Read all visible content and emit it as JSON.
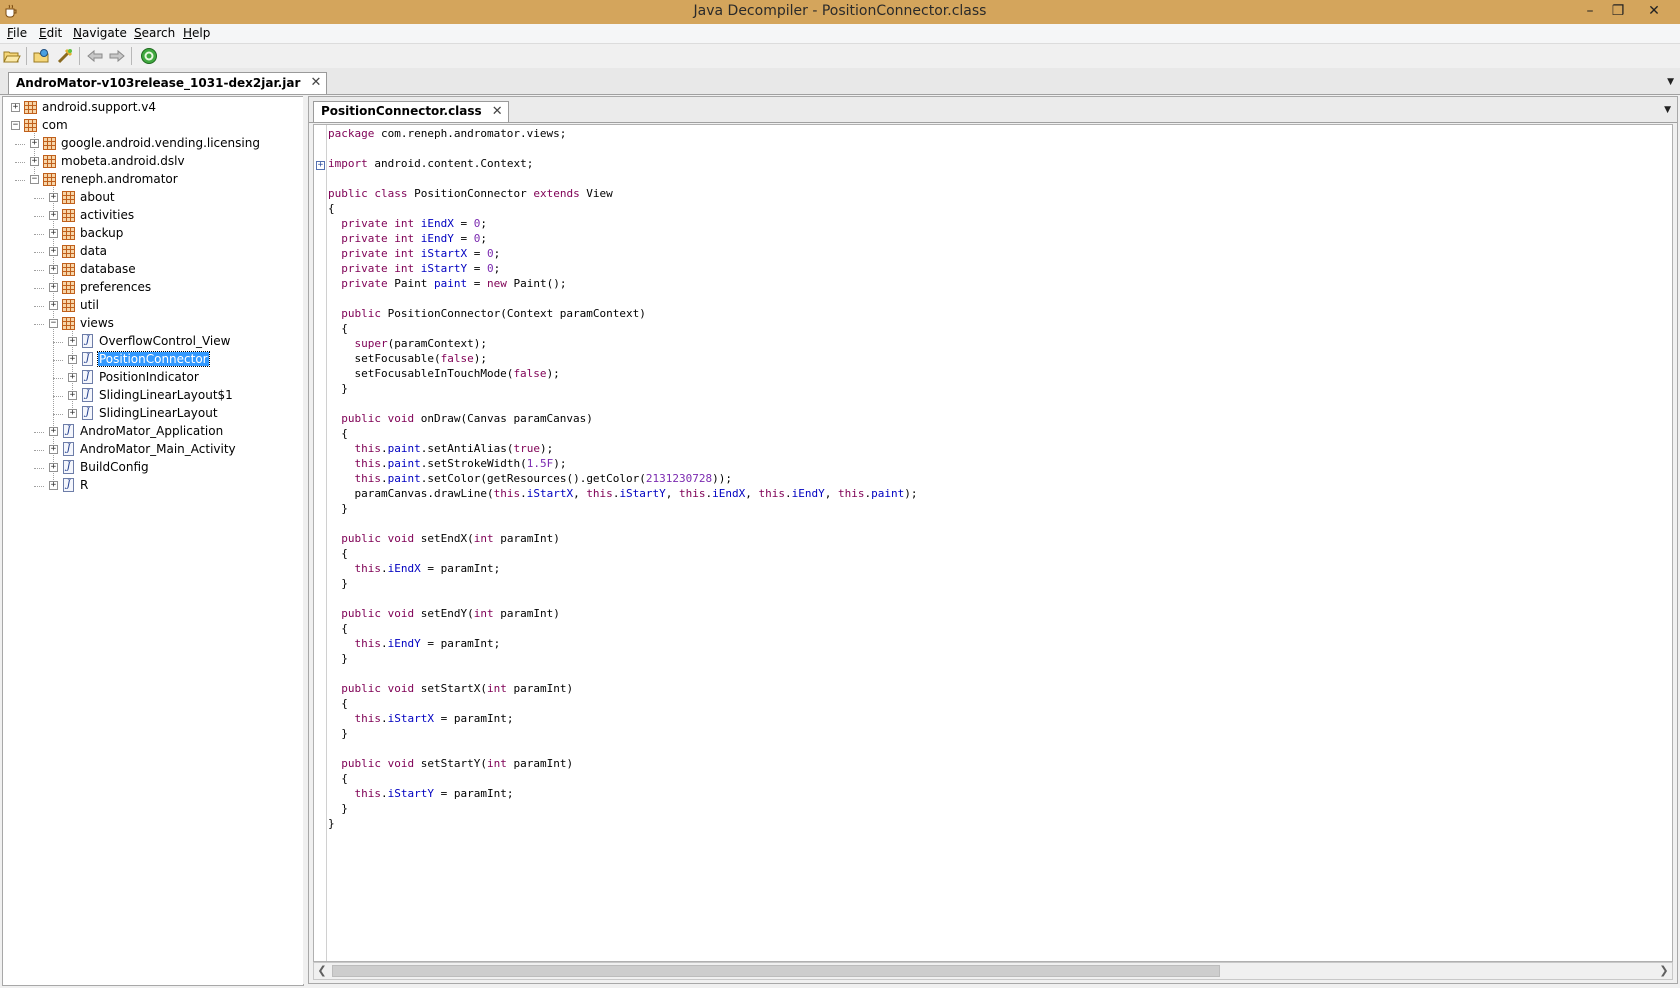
{
  "window": {
    "title": "Java Decompiler - PositionConnector.class",
    "minimize": "–",
    "restore": "❐",
    "close": "✕"
  },
  "menu": [
    {
      "label": "File",
      "mnemonic": "F",
      "rest": "ile"
    },
    {
      "label": "Edit",
      "mnemonic": "E",
      "rest": "dit"
    },
    {
      "label": "Navigate",
      "mnemonic": "N",
      "rest": "avigate"
    },
    {
      "label": "Search",
      "mnemonic": "S",
      "rest": "earch"
    },
    {
      "label": "Help",
      "mnemonic": "H",
      "rest": "elp"
    }
  ],
  "toolbar": {
    "icons": [
      "open-file-icon",
      "open-type-icon",
      "open-type-hierarchy-icon",
      "back-icon",
      "forward-icon",
      "about-icon"
    ]
  },
  "outer_tab": {
    "label": "AndroMator-v103release_1031-dex2jar.jar",
    "close": "✕"
  },
  "editor_tab": {
    "label": "PositionConnector.class",
    "close": "✕"
  },
  "tree": [
    {
      "label": "android.support.v4",
      "type": "package",
      "depth": 0,
      "expanded": false
    },
    {
      "label": "com",
      "type": "package",
      "depth": 0,
      "expanded": true
    },
    {
      "label": "google.android.vending.licensing",
      "type": "package",
      "depth": 1,
      "expanded": false
    },
    {
      "label": "mobeta.android.dslv",
      "type": "package",
      "depth": 1,
      "expanded": false
    },
    {
      "label": "reneph.andromator",
      "type": "package",
      "depth": 1,
      "expanded": true
    },
    {
      "label": "about",
      "type": "package",
      "depth": 2,
      "expanded": false
    },
    {
      "label": "activities",
      "type": "package",
      "depth": 2,
      "expanded": false
    },
    {
      "label": "backup",
      "type": "package",
      "depth": 2,
      "expanded": false
    },
    {
      "label": "data",
      "type": "package",
      "depth": 2,
      "expanded": false
    },
    {
      "label": "database",
      "type": "package",
      "depth": 2,
      "expanded": false
    },
    {
      "label": "preferences",
      "type": "package",
      "depth": 2,
      "expanded": false
    },
    {
      "label": "util",
      "type": "package",
      "depth": 2,
      "expanded": false
    },
    {
      "label": "views",
      "type": "package",
      "depth": 2,
      "expanded": true
    },
    {
      "label": "OverflowControl_View",
      "type": "class",
      "depth": 3,
      "expanded": false
    },
    {
      "label": "PositionConnector",
      "type": "class",
      "depth": 3,
      "expanded": false,
      "selected": true
    },
    {
      "label": "PositionIndicator",
      "type": "class",
      "depth": 3,
      "expanded": false
    },
    {
      "label": "SlidingLinearLayout$1",
      "type": "class",
      "depth": 3,
      "expanded": false
    },
    {
      "label": "SlidingLinearLayout",
      "type": "class",
      "depth": 3,
      "expanded": false
    },
    {
      "label": "AndroMator_Application",
      "type": "class",
      "depth": 2,
      "expanded": false
    },
    {
      "label": "AndroMator_Main_Activity",
      "type": "class",
      "depth": 2,
      "expanded": false
    },
    {
      "label": "BuildConfig",
      "type": "class",
      "depth": 2,
      "expanded": false
    },
    {
      "label": "R",
      "type": "class",
      "depth": 2,
      "expanded": false
    }
  ],
  "code": [
    [
      [
        "k",
        "package"
      ],
      [
        "t",
        " com.reneph.andromator.views;"
      ]
    ],
    [],
    [
      [
        "k",
        "import"
      ],
      [
        "t",
        " android.content.Context;"
      ]
    ],
    [],
    [
      [
        "k",
        "public class"
      ],
      [
        "t",
        " PositionConnector "
      ],
      [
        "k",
        "extends"
      ],
      [
        "t",
        " View"
      ]
    ],
    [
      [
        "t",
        "{"
      ]
    ],
    [
      [
        "t",
        "  "
      ],
      [
        "k",
        "private int"
      ],
      [
        "t",
        " "
      ],
      [
        "f",
        "iEndX"
      ],
      [
        "t",
        " = "
      ],
      [
        "n",
        "0"
      ],
      [
        "t",
        ";"
      ]
    ],
    [
      [
        "t",
        "  "
      ],
      [
        "k",
        "private int"
      ],
      [
        "t",
        " "
      ],
      [
        "f",
        "iEndY"
      ],
      [
        "t",
        " = "
      ],
      [
        "n",
        "0"
      ],
      [
        "t",
        ";"
      ]
    ],
    [
      [
        "t",
        "  "
      ],
      [
        "k",
        "private int"
      ],
      [
        "t",
        " "
      ],
      [
        "f",
        "iStartX"
      ],
      [
        "t",
        " = "
      ],
      [
        "n",
        "0"
      ],
      [
        "t",
        ";"
      ]
    ],
    [
      [
        "t",
        "  "
      ],
      [
        "k",
        "private int"
      ],
      [
        "t",
        " "
      ],
      [
        "f",
        "iStartY"
      ],
      [
        "t",
        " = "
      ],
      [
        "n",
        "0"
      ],
      [
        "t",
        ";"
      ]
    ],
    [
      [
        "t",
        "  "
      ],
      [
        "k",
        "private"
      ],
      [
        "t",
        " Paint "
      ],
      [
        "f",
        "paint"
      ],
      [
        "t",
        " = "
      ],
      [
        "k",
        "new"
      ],
      [
        "t",
        " Paint();"
      ]
    ],
    [],
    [
      [
        "t",
        "  "
      ],
      [
        "k",
        "public"
      ],
      [
        "t",
        " PositionConnector(Context paramContext)"
      ]
    ],
    [
      [
        "t",
        "  {"
      ]
    ],
    [
      [
        "t",
        "    "
      ],
      [
        "k",
        "super"
      ],
      [
        "t",
        "(paramContext);"
      ]
    ],
    [
      [
        "t",
        "    setFocusable("
      ],
      [
        "k",
        "false"
      ],
      [
        "t",
        ");"
      ]
    ],
    [
      [
        "t",
        "    setFocusableInTouchMode("
      ],
      [
        "k",
        "false"
      ],
      [
        "t",
        ");"
      ]
    ],
    [
      [
        "t",
        "  }"
      ]
    ],
    [],
    [
      [
        "t",
        "  "
      ],
      [
        "k",
        "public void"
      ],
      [
        "t",
        " onDraw(Canvas paramCanvas)"
      ]
    ],
    [
      [
        "t",
        "  {"
      ]
    ],
    [
      [
        "t",
        "    "
      ],
      [
        "k",
        "this"
      ],
      [
        "t",
        "."
      ],
      [
        "f",
        "paint"
      ],
      [
        "t",
        ".setAntiAlias("
      ],
      [
        "k",
        "true"
      ],
      [
        "t",
        ");"
      ]
    ],
    [
      [
        "t",
        "    "
      ],
      [
        "k",
        "this"
      ],
      [
        "t",
        "."
      ],
      [
        "f",
        "paint"
      ],
      [
        "t",
        ".setStrokeWidth("
      ],
      [
        "n",
        "1.5F"
      ],
      [
        "t",
        ");"
      ]
    ],
    [
      [
        "t",
        "    "
      ],
      [
        "k",
        "this"
      ],
      [
        "t",
        "."
      ],
      [
        "f",
        "paint"
      ],
      [
        "t",
        ".setColor(getResources().getColor("
      ],
      [
        "n",
        "2131230728"
      ],
      [
        "t",
        "));"
      ]
    ],
    [
      [
        "t",
        "    paramCanvas.drawLine("
      ],
      [
        "k",
        "this"
      ],
      [
        "t",
        "."
      ],
      [
        "f",
        "iStartX"
      ],
      [
        "t",
        ", "
      ],
      [
        "k",
        "this"
      ],
      [
        "t",
        "."
      ],
      [
        "f",
        "iStartY"
      ],
      [
        "t",
        ", "
      ],
      [
        "k",
        "this"
      ],
      [
        "t",
        "."
      ],
      [
        "f",
        "iEndX"
      ],
      [
        "t",
        ", "
      ],
      [
        "k",
        "this"
      ],
      [
        "t",
        "."
      ],
      [
        "f",
        "iEndY"
      ],
      [
        "t",
        ", "
      ],
      [
        "k",
        "this"
      ],
      [
        "t",
        "."
      ],
      [
        "f",
        "paint"
      ],
      [
        "t",
        ");"
      ]
    ],
    [
      [
        "t",
        "  }"
      ]
    ],
    [],
    [
      [
        "t",
        "  "
      ],
      [
        "k",
        "public void"
      ],
      [
        "t",
        " setEndX("
      ],
      [
        "k",
        "int"
      ],
      [
        "t",
        " paramInt)"
      ]
    ],
    [
      [
        "t",
        "  {"
      ]
    ],
    [
      [
        "t",
        "    "
      ],
      [
        "k",
        "this"
      ],
      [
        "t",
        "."
      ],
      [
        "f",
        "iEndX"
      ],
      [
        "t",
        " = paramInt;"
      ]
    ],
    [
      [
        "t",
        "  }"
      ]
    ],
    [],
    [
      [
        "t",
        "  "
      ],
      [
        "k",
        "public void"
      ],
      [
        "t",
        " setEndY("
      ],
      [
        "k",
        "int"
      ],
      [
        "t",
        " paramInt)"
      ]
    ],
    [
      [
        "t",
        "  {"
      ]
    ],
    [
      [
        "t",
        "    "
      ],
      [
        "k",
        "this"
      ],
      [
        "t",
        "."
      ],
      [
        "f",
        "iEndY"
      ],
      [
        "t",
        " = paramInt;"
      ]
    ],
    [
      [
        "t",
        "  }"
      ]
    ],
    [],
    [
      [
        "t",
        "  "
      ],
      [
        "k",
        "public void"
      ],
      [
        "t",
        " setStartX("
      ],
      [
        "k",
        "int"
      ],
      [
        "t",
        " paramInt)"
      ]
    ],
    [
      [
        "t",
        "  {"
      ]
    ],
    [
      [
        "t",
        "    "
      ],
      [
        "k",
        "this"
      ],
      [
        "t",
        "."
      ],
      [
        "f",
        "iStartX"
      ],
      [
        "t",
        " = paramInt;"
      ]
    ],
    [
      [
        "t",
        "  }"
      ]
    ],
    [],
    [
      [
        "t",
        "  "
      ],
      [
        "k",
        "public void"
      ],
      [
        "t",
        " setStartY("
      ],
      [
        "k",
        "int"
      ],
      [
        "t",
        " paramInt)"
      ]
    ],
    [
      [
        "t",
        "  {"
      ]
    ],
    [
      [
        "t",
        "    "
      ],
      [
        "k",
        "this"
      ],
      [
        "t",
        "."
      ],
      [
        "f",
        "iStartY"
      ],
      [
        "t",
        " = paramInt;"
      ]
    ],
    [
      [
        "t",
        "  }"
      ]
    ],
    [
      [
        "t",
        "}"
      ]
    ]
  ],
  "colors": {
    "titlebar": "#d4a55c",
    "keyword": "#7f0055",
    "field": "#0000c0",
    "number": "#7b2ab0",
    "selection": "#3399ff"
  }
}
